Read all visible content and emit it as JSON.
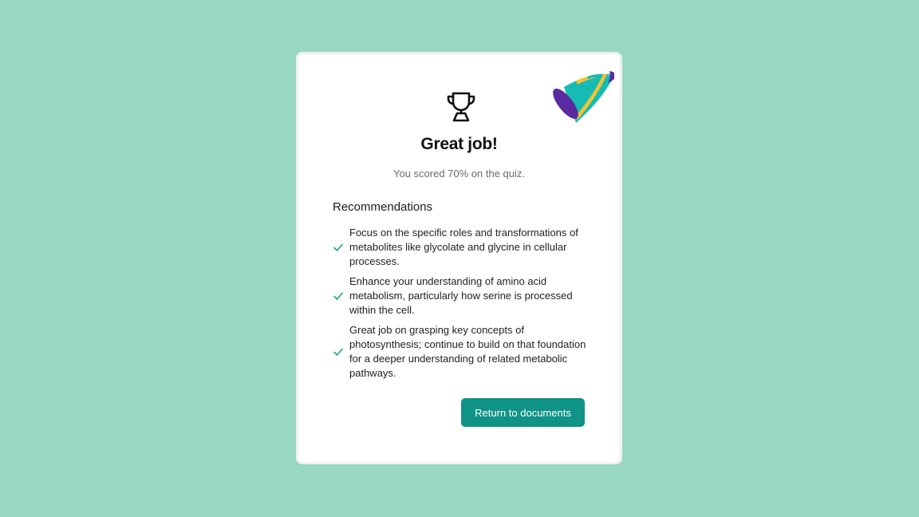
{
  "colors": {
    "background": "#98d8c2",
    "card": "#ffffff",
    "accent": "#0f9386",
    "check": "#1aa77a"
  },
  "icons": {
    "party": "party-popper-icon",
    "trophy": "trophy-icon",
    "check": "check-icon"
  },
  "result": {
    "title": "Great job!",
    "score_text": "You scored 70% on the quiz."
  },
  "recommendations": {
    "heading": "Recommendations",
    "items": [
      {
        "text": "Focus on the specific roles and transformations of metabolites like glycolate and glycine in cellular processes."
      },
      {
        "text": "Enhance your understanding of amino acid metabolism, particularly how serine is processed within the cell."
      },
      {
        "text": "Great job on grasping key concepts of photosynthesis; continue to build on that foundation for a deeper understanding of related metabolic pathways."
      }
    ]
  },
  "actions": {
    "return_label": "Return to documents"
  }
}
